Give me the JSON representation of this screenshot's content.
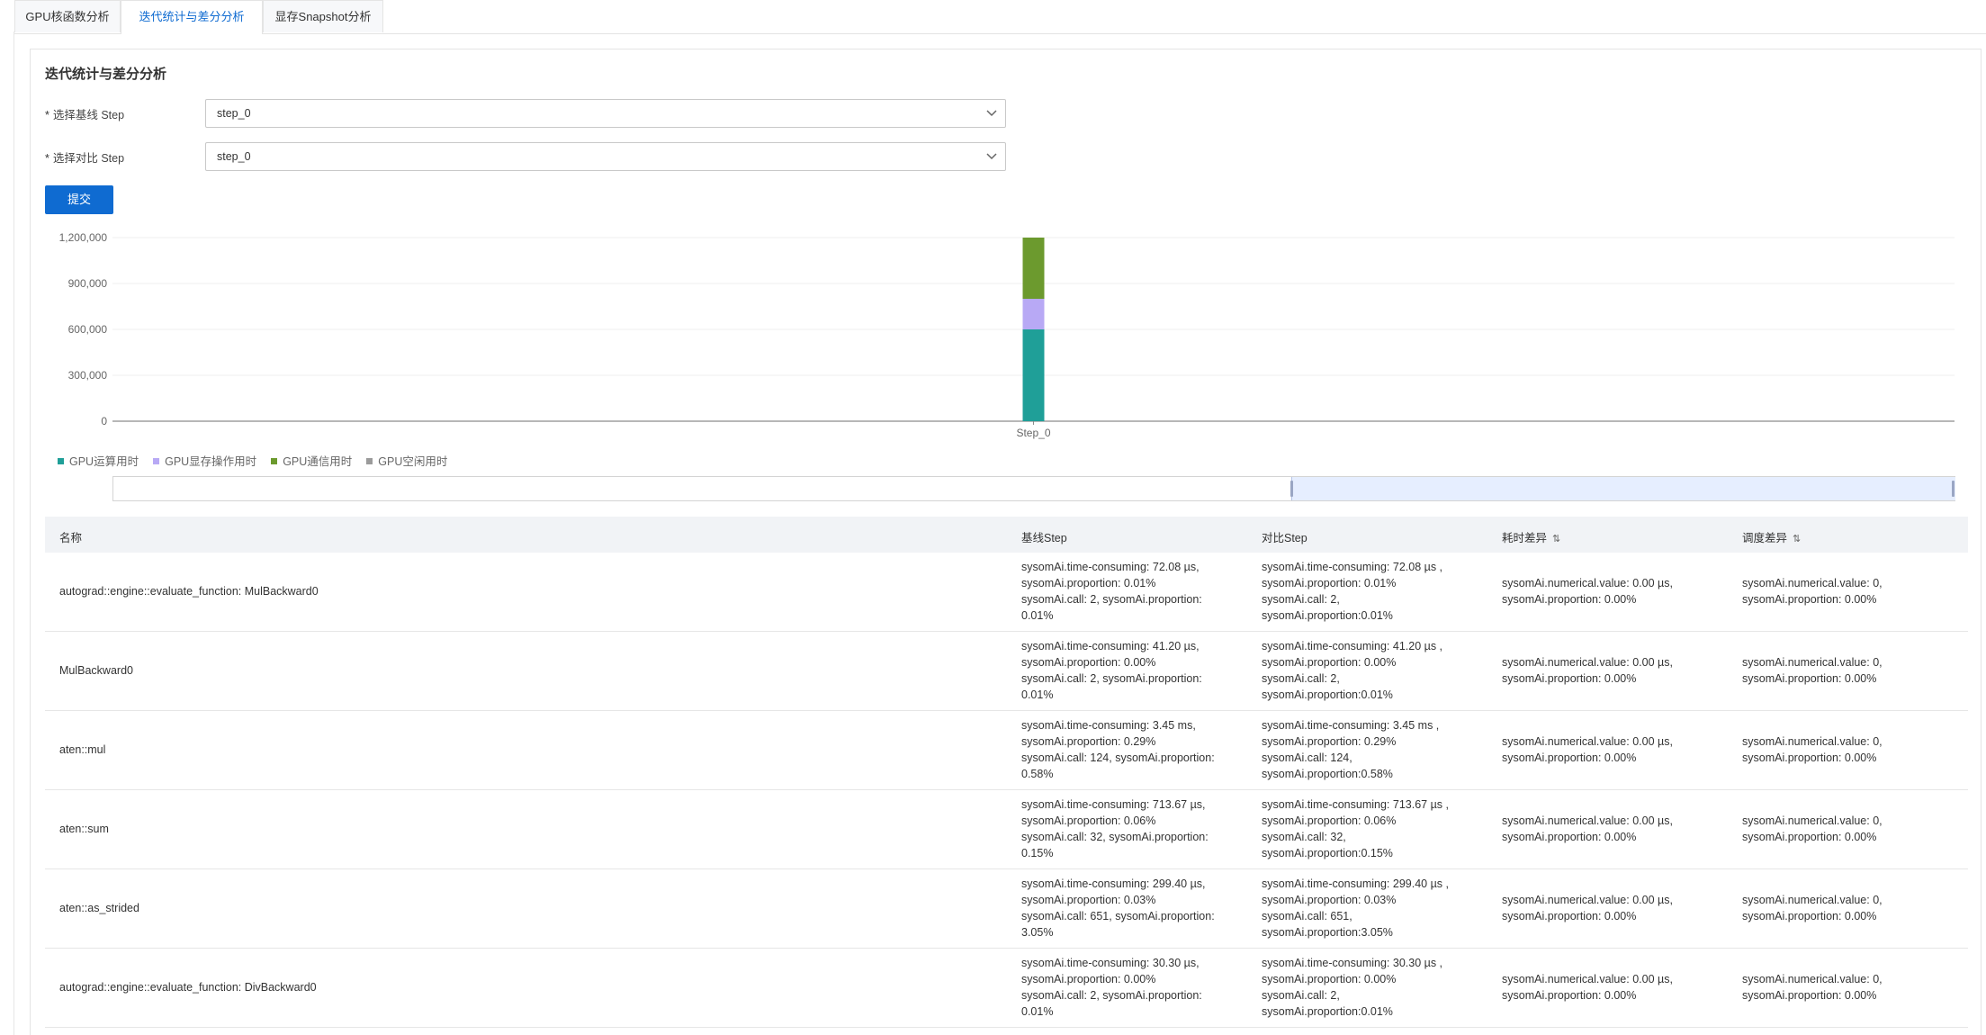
{
  "tabs": [
    "GPU核函数分析",
    "迭代统计与差分分析",
    "显存Snapshot分析"
  ],
  "active_tab": 1,
  "card": {
    "title": "迭代统计与差分分析",
    "baseline_label": "选择基线 Step",
    "baseline_value": "step_0",
    "compare_label": "选择对比 Step",
    "compare_value": "step_0",
    "required_mark": "*",
    "submit": "提交"
  },
  "chart_data": {
    "type": "bar",
    "stacked": true,
    "categories": [
      "Step_0"
    ],
    "yticks": [
      "1,200,000",
      "900,000",
      "600,000",
      "300,000",
      "0"
    ],
    "ylim": [
      0,
      1200000
    ],
    "grid": true,
    "legend_position": "bottom-left",
    "series": [
      {
        "name": "GPU运算用时",
        "color": "#1f9f98",
        "values": [
          600000
        ]
      },
      {
        "name": "GPU显存操作用时",
        "color": "#b8a9f5",
        "values": [
          200000
        ]
      },
      {
        "name": "GPU通信用时",
        "color": "#6c9a2e",
        "values": [
          400000
        ]
      },
      {
        "name": "GPU空闲用时",
        "color": "#9b9b9b",
        "values": [
          0
        ]
      }
    ]
  },
  "zoom": {
    "start": 0.64,
    "end": 1.0
  },
  "table": {
    "headers": [
      "名称",
      "基线Step",
      "对比Step",
      "耗时差异",
      "调度差异"
    ],
    "sort_icon": "⇅",
    "rows": [
      {
        "name": "autograd::engine::evaluate_function: MulBackward0",
        "base": [
          "sysomAi.time-consuming: 72.08 µs,",
          "sysomAi.proportion: 0.01%",
          "sysomAi.call: 2, sysomAi.proportion:",
          "0.01%"
        ],
        "compare": [
          "sysomAi.time-consuming: 72.08 µs ,",
          "sysomAi.proportion: 0.01%",
          "sysomAi.call: 2,",
          "sysomAi.proportion:0.01%"
        ],
        "time_diff": [
          "sysomAi.numerical.value: 0.00 µs,",
          "sysomAi.proportion: 0.00%"
        ],
        "sched_diff": [
          "sysomAi.numerical.value: 0,",
          "sysomAi.proportion: 0.00%"
        ]
      },
      {
        "name": "MulBackward0",
        "base": [
          "sysomAi.time-consuming: 41.20 µs,",
          "sysomAi.proportion: 0.00%",
          "sysomAi.call: 2, sysomAi.proportion:",
          "0.01%"
        ],
        "compare": [
          "sysomAi.time-consuming: 41.20 µs ,",
          "sysomAi.proportion: 0.00%",
          "sysomAi.call: 2,",
          "sysomAi.proportion:0.01%"
        ],
        "time_diff": [
          "sysomAi.numerical.value: 0.00 µs,",
          "sysomAi.proportion: 0.00%"
        ],
        "sched_diff": [
          "sysomAi.numerical.value: 0,",
          "sysomAi.proportion: 0.00%"
        ]
      },
      {
        "name": "aten::mul",
        "base": [
          "sysomAi.time-consuming: 3.45 ms,",
          "sysomAi.proportion: 0.29%",
          "sysomAi.call: 124, sysomAi.proportion:",
          "0.58%"
        ],
        "compare": [
          "sysomAi.time-consuming: 3.45 ms ,",
          "sysomAi.proportion: 0.29%",
          "sysomAi.call: 124,",
          "sysomAi.proportion:0.58%"
        ],
        "time_diff": [
          "sysomAi.numerical.value: 0.00 µs,",
          "sysomAi.proportion: 0.00%"
        ],
        "sched_diff": [
          "sysomAi.numerical.value: 0,",
          "sysomAi.proportion: 0.00%"
        ]
      },
      {
        "name": "aten::sum",
        "base": [
          "sysomAi.time-consuming: 713.67 µs,",
          "sysomAi.proportion: 0.06%",
          "sysomAi.call: 32, sysomAi.proportion:",
          "0.15%"
        ],
        "compare": [
          "sysomAi.time-consuming: 713.67 µs ,",
          "sysomAi.proportion: 0.06%",
          "sysomAi.call: 32,",
          "sysomAi.proportion:0.15%"
        ],
        "time_diff": [
          "sysomAi.numerical.value: 0.00 µs,",
          "sysomAi.proportion: 0.00%"
        ],
        "sched_diff": [
          "sysomAi.numerical.value: 0,",
          "sysomAi.proportion: 0.00%"
        ]
      },
      {
        "name": "aten::as_strided",
        "base": [
          "sysomAi.time-consuming: 299.40 µs,",
          "sysomAi.proportion: 0.03%",
          "sysomAi.call: 651, sysomAi.proportion:",
          "3.05%"
        ],
        "compare": [
          "sysomAi.time-consuming: 299.40 µs ,",
          "sysomAi.proportion: 0.03%",
          "sysomAi.call: 651,",
          "sysomAi.proportion:3.05%"
        ],
        "time_diff": [
          "sysomAi.numerical.value: 0.00 µs,",
          "sysomAi.proportion: 0.00%"
        ],
        "sched_diff": [
          "sysomAi.numerical.value: 0,",
          "sysomAi.proportion: 0.00%"
        ]
      },
      {
        "name": "autograd::engine::evaluate_function: DivBackward0",
        "base": [
          "sysomAi.time-consuming: 30.30 µs,",
          "sysomAi.proportion: 0.00%",
          "sysomAi.call: 2, sysomAi.proportion:",
          "0.01%"
        ],
        "compare": [
          "sysomAi.time-consuming: 30.30 µs ,",
          "sysomAi.proportion: 0.00%",
          "sysomAi.call: 2,",
          "sysomAi.proportion:0.01%"
        ],
        "time_diff": [
          "sysomAi.numerical.value: 0.00 µs,",
          "sysomAi.proportion: 0.00%"
        ],
        "sched_diff": [
          "sysomAi.numerical.value: 0,",
          "sysomAi.proportion: 0.00%"
        ]
      }
    ]
  }
}
